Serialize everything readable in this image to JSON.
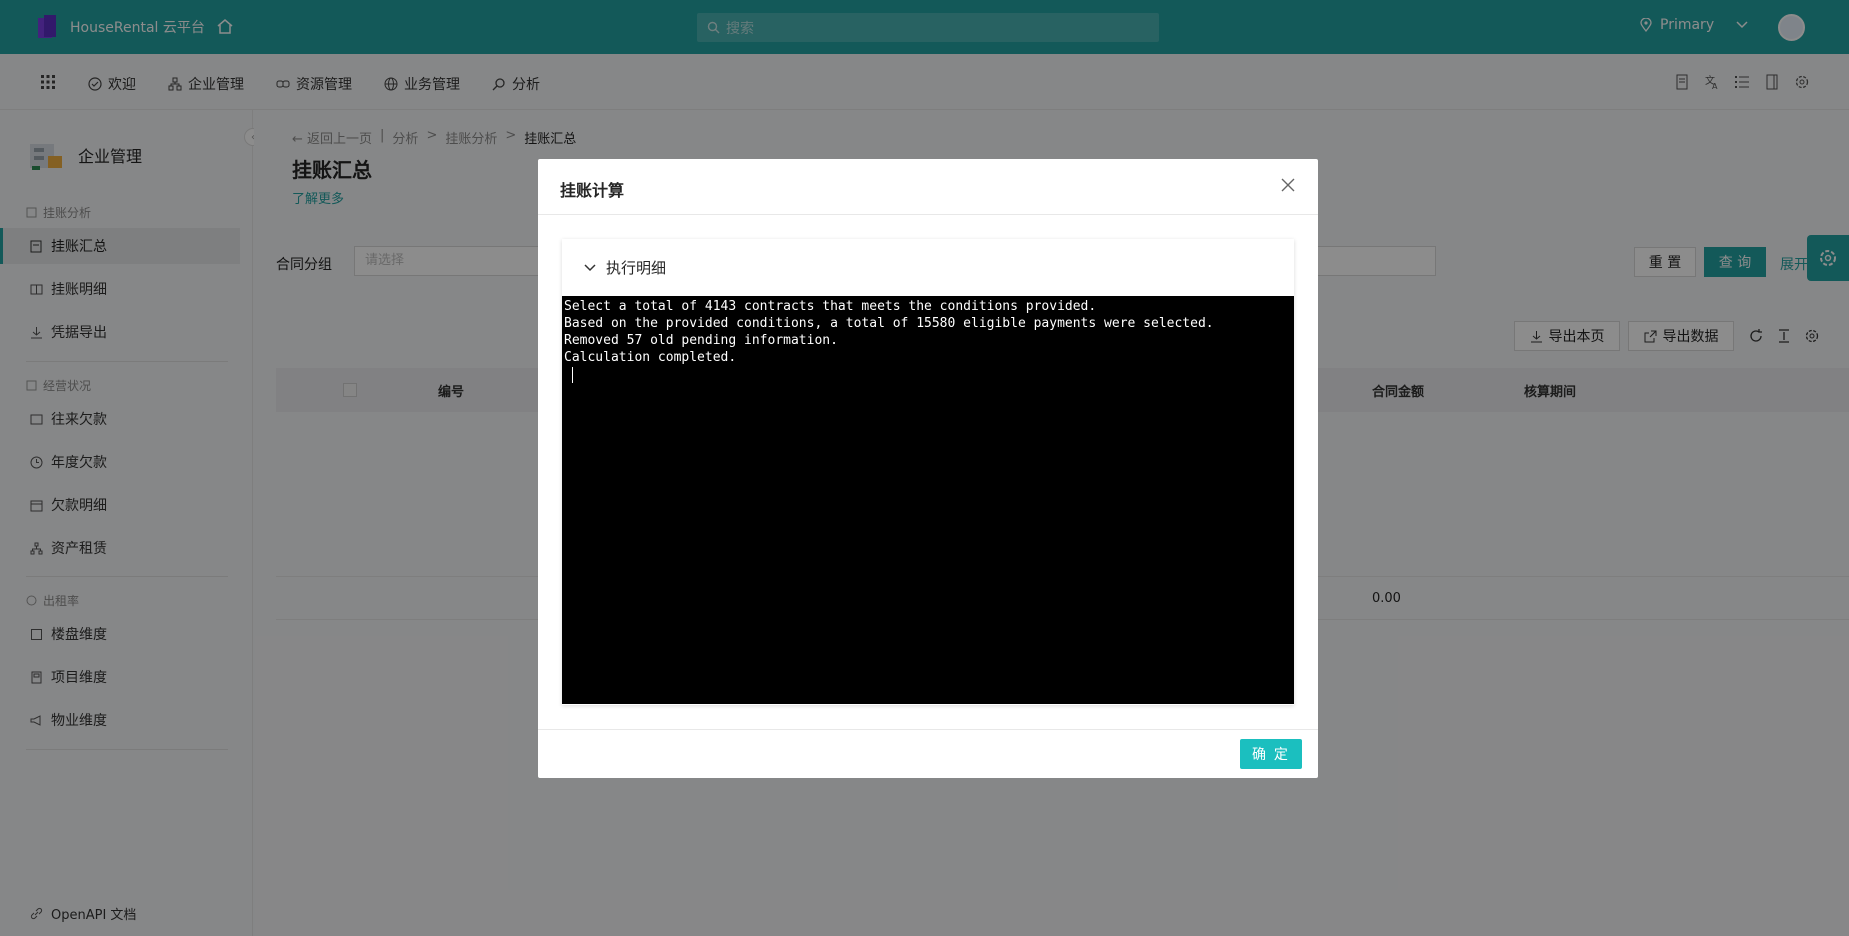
{
  "header": {
    "app_name": "HouseRental 云平台",
    "search_placeholder": "搜索",
    "region": "Primary"
  },
  "nav": {
    "items": [
      {
        "label": "欢迎"
      },
      {
        "label": "企业管理"
      },
      {
        "label": "资源管理"
      },
      {
        "label": "业务管理"
      },
      {
        "label": "分析"
      }
    ]
  },
  "sidebar": {
    "title": "企业管理",
    "sections": [
      {
        "title": "挂账分析",
        "items": [
          "挂账汇总",
          "挂账明细",
          "凭据导出"
        ]
      },
      {
        "title": "经营状况",
        "items": [
          "往来欠款",
          "年度欠款",
          "欠款明细",
          "资产租赁"
        ]
      },
      {
        "title": "出租率",
        "items": [
          "楼盘维度",
          "项目维度",
          "物业维度"
        ]
      }
    ],
    "footer_link": "OpenAPI 文档"
  },
  "main": {
    "back": "← 返回上一页",
    "separator": "|",
    "breadcrumb": [
      "分析",
      "挂账分析",
      "挂账汇总"
    ],
    "title": "挂账汇总",
    "learn_more": "了解更多",
    "filter_label": "合同分组",
    "filter_placeholder": "请选择",
    "buttons": {
      "reset": "重 置",
      "query": "查 询",
      "expand": "展开"
    },
    "toolbar": {
      "export_page": "导出本页",
      "export_data": "导出数据"
    },
    "columns": {
      "no": "编号",
      "amount": "合同金额",
      "period": "核算期间"
    },
    "summary_amount": "0.00"
  },
  "modal": {
    "title": "挂账计算",
    "section_title": "执行明细",
    "log": "Select a total of 4143 contracts that meets the conditions provided.\nBased on the provided conditions, a total of 15580 eligible payments were selected.\nRemoved 57 old pending information.\nCalculation completed.\n",
    "ok": "确 定"
  },
  "colors": {
    "accent": "#23a2a2",
    "ok_button": "#1bbfbf"
  }
}
